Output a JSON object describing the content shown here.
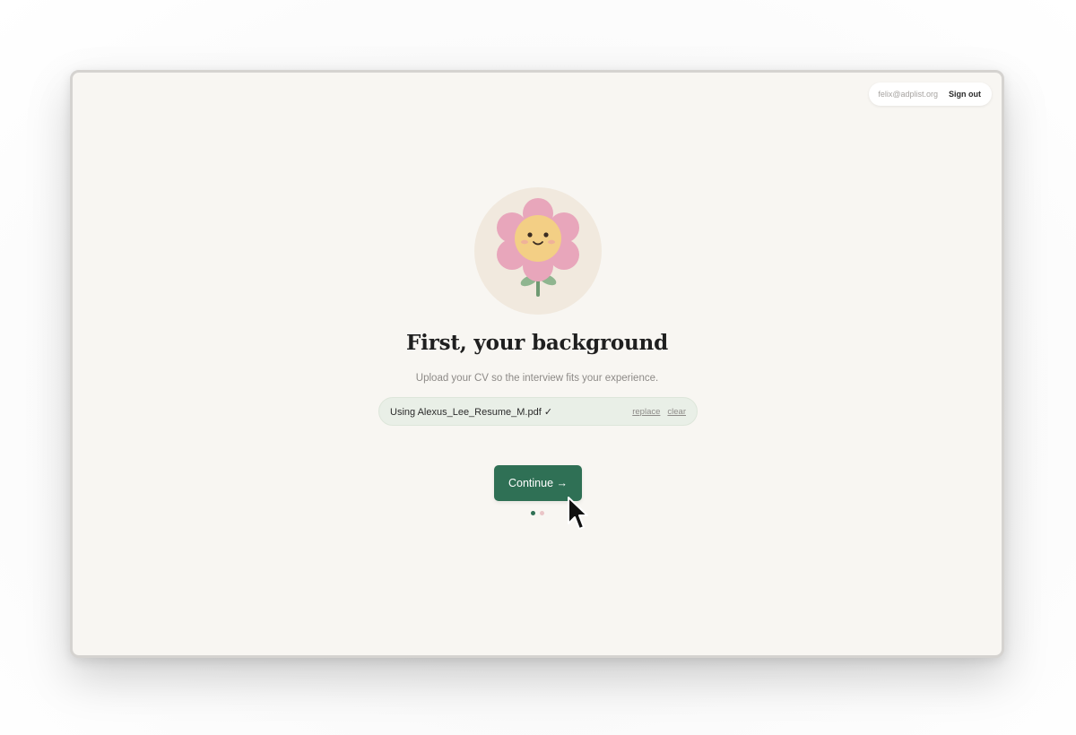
{
  "header": {
    "email": "felix@adplist.org",
    "sign_out_label": "Sign out"
  },
  "main": {
    "illustration": "flower-smiley-icon",
    "title": "First, your background",
    "subtitle": "Upload your CV so the interview fits your experience.",
    "file_bar": {
      "status_text": "Using Alexus_Lee_Resume_M.pdf ✓",
      "replace_label": "replace",
      "clear_label": "clear"
    },
    "continue_label": "Continue →",
    "steps": {
      "current": 1,
      "total": 2
    }
  },
  "colors": {
    "page_background": "#f8f6f2",
    "primary": "#2f7055",
    "file_bar_background": "#e9efe7",
    "inactive_dot": "#eac5c7"
  }
}
